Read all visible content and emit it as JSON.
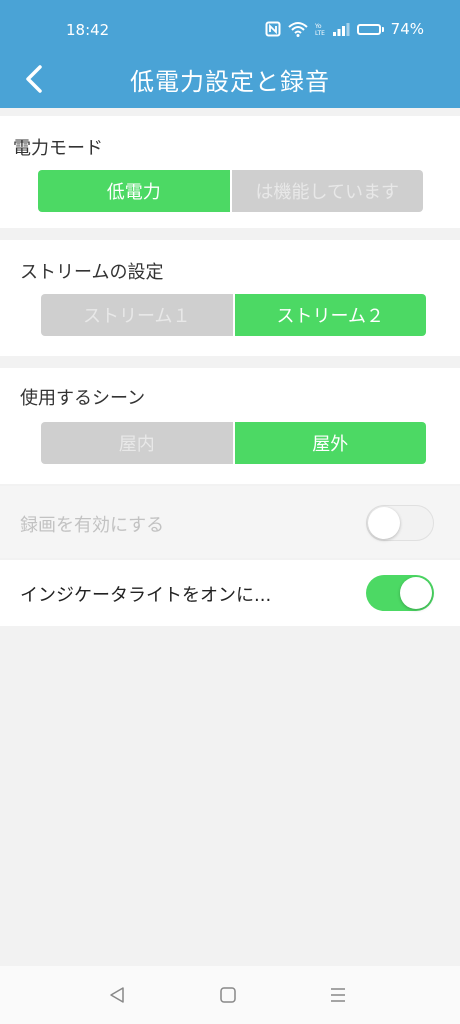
{
  "status_bar": {
    "time": "18:42",
    "battery": "74%",
    "battery_level": 0.74,
    "network_label": "Yo\nLTE"
  },
  "header": {
    "title": "低電力設定と録音"
  },
  "power_mode": {
    "label": "電力モード",
    "options": [
      "低電力",
      "は機能しています"
    ],
    "selected": 0
  },
  "stream_settings": {
    "label": "ストリームの設定",
    "options": [
      "ストリーム１",
      "ストリーム２"
    ],
    "selected": 1
  },
  "scene": {
    "label": "使用するシーン",
    "options": [
      "屋内",
      "屋外"
    ],
    "selected": 1
  },
  "recording": {
    "label": "録画を有効にする",
    "enabled": false,
    "disabled": true
  },
  "indicator_light": {
    "label": "インジケータライトをオンに...",
    "enabled": true
  },
  "colors": {
    "header": "#4aa3d6",
    "accent_green": "#4cd964",
    "inactive_segment": "#cfcfcf",
    "battery_fill": "#f5c518"
  },
  "icons": {
    "back": "chevron-left-icon",
    "nfc": "nfc-icon",
    "wifi": "wifi-icon",
    "signal": "signal-icon",
    "battery": "battery-icon",
    "nav_back": "triangle-back-icon",
    "nav_home": "square-home-icon",
    "nav_menu": "menu-icon"
  }
}
